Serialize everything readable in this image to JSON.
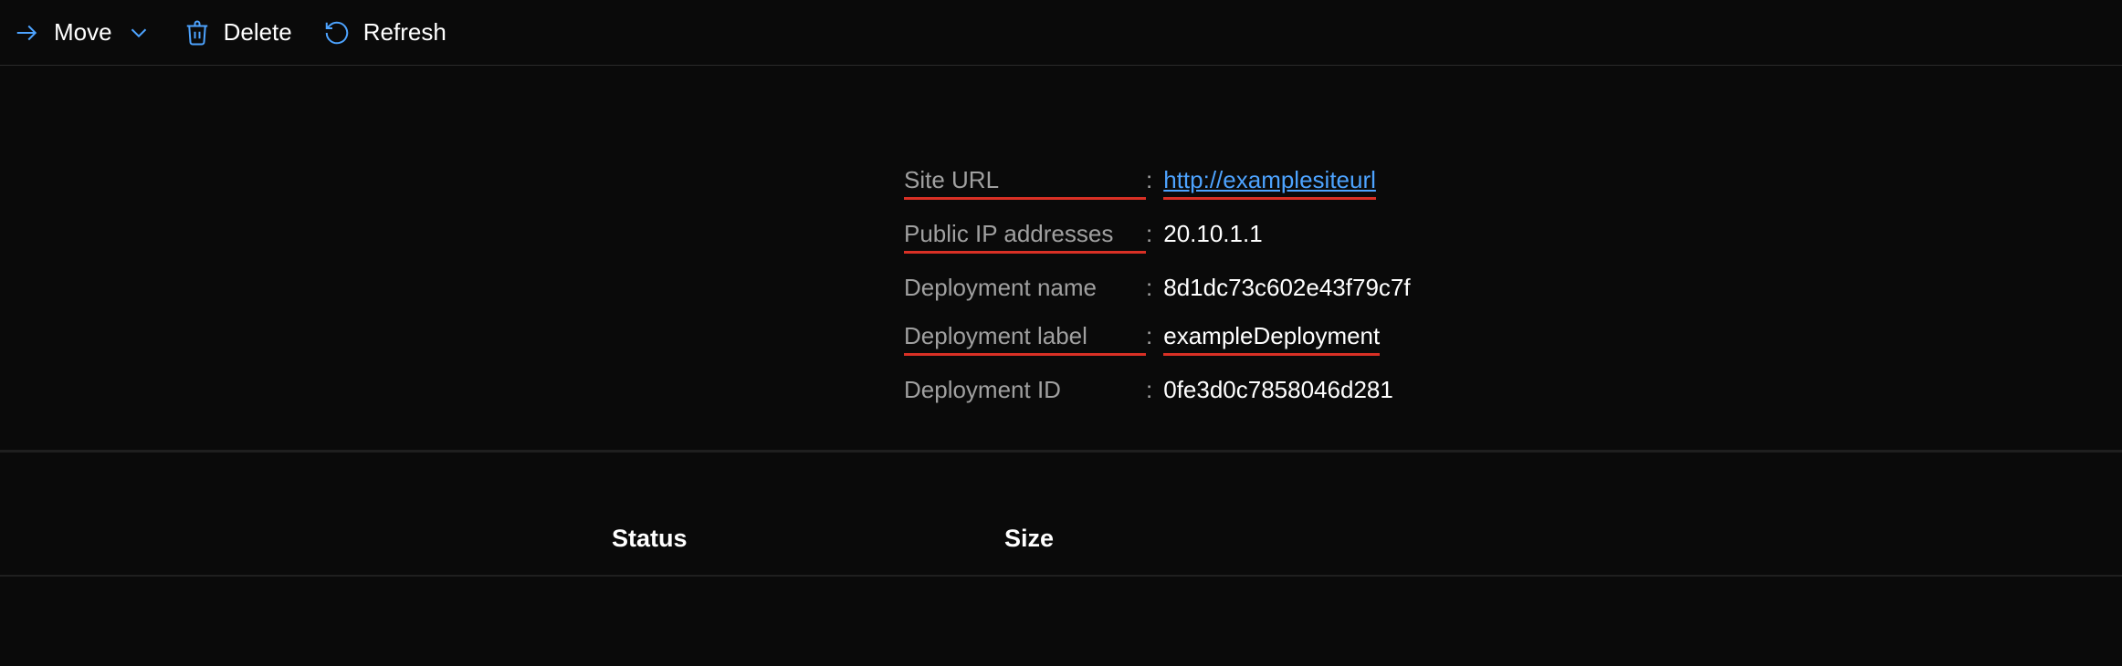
{
  "toolbar": {
    "move_label": "Move",
    "delete_label": "Delete",
    "refresh_label": "Refresh"
  },
  "properties": {
    "site_url": {
      "label": "Site URL",
      "value": "http://examplesiteurl"
    },
    "public_ip": {
      "label": "Public IP addresses",
      "value": "20.10.1.1"
    },
    "deployment_name": {
      "label": "Deployment name",
      "value": "8d1dc73c602e43f79c7f"
    },
    "deployment_label": {
      "label": "Deployment label",
      "value": "exampleDeployment"
    },
    "deployment_id": {
      "label": "Deployment ID",
      "value": "0fe3d0c7858046d281"
    }
  },
  "table": {
    "columns": {
      "status": "Status",
      "size": "Size"
    }
  }
}
